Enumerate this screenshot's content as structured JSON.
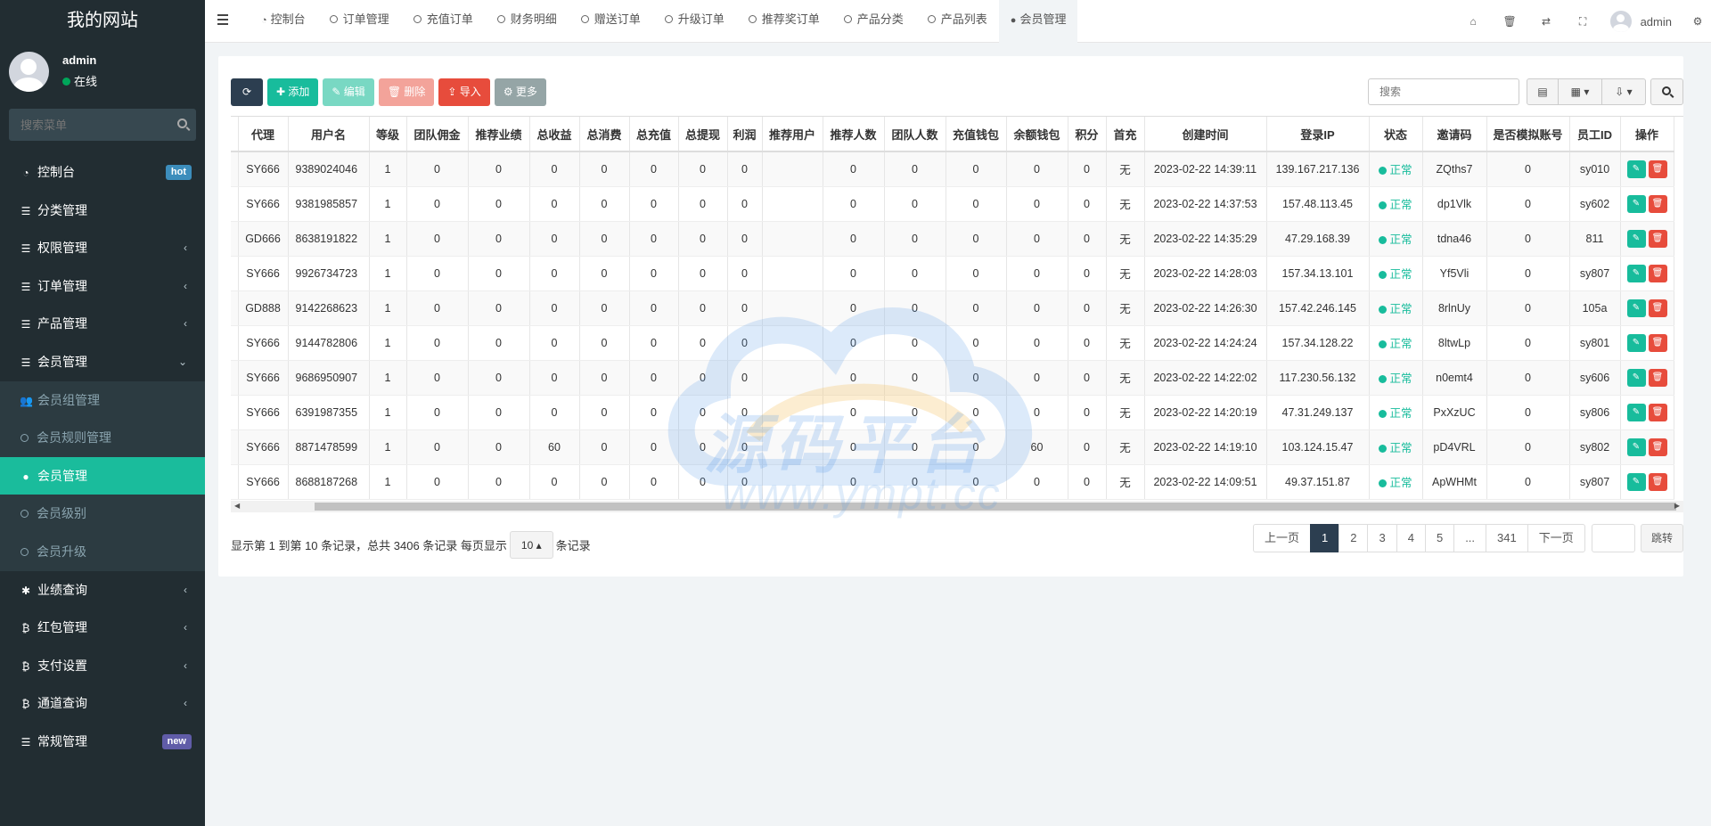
{
  "sidebar": {
    "logo": "我的网站",
    "user": {
      "name": "admin",
      "status": "在线"
    },
    "search_placeholder": "搜索菜单",
    "menu": [
      {
        "label": "控制台",
        "icon": "dashboard-icon",
        "badge": "hot",
        "badge_color": "#3c8dbc"
      },
      {
        "label": "分类管理",
        "icon": "list-icon"
      },
      {
        "label": "权限管理",
        "icon": "list-icon",
        "chevron": "‹"
      },
      {
        "label": "订单管理",
        "icon": "list-icon",
        "chevron": "‹"
      },
      {
        "label": "产品管理",
        "icon": "list-icon",
        "chevron": "‹"
      },
      {
        "label": "会员管理",
        "icon": "list-icon",
        "chevron": "⌄"
      }
    ],
    "submenu": [
      {
        "label": "会员组管理",
        "icon": "users-icon"
      },
      {
        "label": "会员规则管理",
        "icon": "circle-icon"
      },
      {
        "label": "会员管理",
        "icon": "user-icon",
        "active": true
      },
      {
        "label": "会员级别",
        "icon": "circle-icon"
      },
      {
        "label": "会员升级",
        "icon": "circle-icon"
      }
    ],
    "menu2": [
      {
        "label": "业绩查询",
        "icon": "asterisk-icon",
        "chevron": "‹"
      },
      {
        "label": "红包管理",
        "icon": "bitcoin-icon",
        "chevron": "‹"
      },
      {
        "label": "支付设置",
        "icon": "bitcoin-icon",
        "chevron": "‹"
      },
      {
        "label": "通道查询",
        "icon": "bitcoin-icon",
        "chevron": "‹"
      },
      {
        "label": "常规管理",
        "icon": "list-icon",
        "badge": "new",
        "badge_color": "#605ca8"
      }
    ]
  },
  "topbar": {
    "tabs": [
      {
        "label": "控制台",
        "icon": "dashboard-icon"
      },
      {
        "label": "订单管理",
        "icon": "circle-icon"
      },
      {
        "label": "充值订单",
        "icon": "circle-icon"
      },
      {
        "label": "财务明细",
        "icon": "circle-icon"
      },
      {
        "label": "赠送订单",
        "icon": "circle-icon"
      },
      {
        "label": "升级订单",
        "icon": "circle-icon"
      },
      {
        "label": "推荐奖订单",
        "icon": "circle-icon"
      },
      {
        "label": "产品分类",
        "icon": "circle-icon"
      },
      {
        "label": "产品列表",
        "icon": "circle-icon"
      },
      {
        "label": "会员管理",
        "icon": "user-icon",
        "active": true
      }
    ],
    "icons": [
      "home-icon",
      "trash-icon",
      "language-icon",
      "fullscreen-icon"
    ],
    "user": "admin",
    "settings_icon": "gears-icon"
  },
  "toolbar": {
    "refresh": "",
    "add": "添加",
    "edit": "编辑",
    "delete": "删除",
    "import": "导入",
    "more": "更多",
    "search_placeholder": "搜索"
  },
  "table": {
    "columns": [
      "代理",
      "用户名",
      "等级",
      "团队佣金",
      "推荐业绩",
      "总收益",
      "总消费",
      "总充值",
      "总提现",
      "利润",
      "推荐用户",
      "推荐人数",
      "团队人数",
      "充值钱包",
      "余额钱包",
      "积分",
      "首充",
      "创建时间",
      "登录IP",
      "状态",
      "邀请码",
      "是否模拟账号",
      "员工ID",
      "操作"
    ],
    "rows": [
      [
        "SY666",
        "9389024046",
        "1",
        "0",
        "0",
        "0",
        "0",
        "0",
        "0",
        "0",
        "",
        "0",
        "0",
        "0",
        "0",
        "0",
        "无",
        "2023-02-22 14:39:11",
        "139.167.217.136",
        "正常",
        "ZQths7",
        "0",
        "sy010"
      ],
      [
        "SY666",
        "9381985857",
        "1",
        "0",
        "0",
        "0",
        "0",
        "0",
        "0",
        "0",
        "",
        "0",
        "0",
        "0",
        "0",
        "0",
        "无",
        "2023-02-22 14:37:53",
        "157.48.113.45",
        "正常",
        "dp1Vlk",
        "0",
        "sy602"
      ],
      [
        "GD666",
        "8638191822",
        "1",
        "0",
        "0",
        "0",
        "0",
        "0",
        "0",
        "0",
        "",
        "0",
        "0",
        "0",
        "0",
        "0",
        "无",
        "2023-02-22 14:35:29",
        "47.29.168.39",
        "正常",
        "tdna46",
        "0",
        "811"
      ],
      [
        "SY666",
        "9926734723",
        "1",
        "0",
        "0",
        "0",
        "0",
        "0",
        "0",
        "0",
        "",
        "0",
        "0",
        "0",
        "0",
        "0",
        "无",
        "2023-02-22 14:28:03",
        "157.34.13.101",
        "正常",
        "Yf5Vli",
        "0",
        "sy807"
      ],
      [
        "GD888",
        "9142268623",
        "1",
        "0",
        "0",
        "0",
        "0",
        "0",
        "0",
        "0",
        "",
        "0",
        "0",
        "0",
        "0",
        "0",
        "无",
        "2023-02-22 14:26:30",
        "157.42.246.145",
        "正常",
        "8rlnUy",
        "0",
        "105a"
      ],
      [
        "SY666",
        "9144782806",
        "1",
        "0",
        "0",
        "0",
        "0",
        "0",
        "0",
        "0",
        "",
        "0",
        "0",
        "0",
        "0",
        "0",
        "无",
        "2023-02-22 14:24:24",
        "157.34.128.22",
        "正常",
        "8ltwLp",
        "0",
        "sy801"
      ],
      [
        "SY666",
        "9686950907",
        "1",
        "0",
        "0",
        "0",
        "0",
        "0",
        "0",
        "0",
        "",
        "0",
        "0",
        "0",
        "0",
        "0",
        "无",
        "2023-02-22 14:22:02",
        "117.230.56.132",
        "正常",
        "n0emt4",
        "0",
        "sy606"
      ],
      [
        "SY666",
        "6391987355",
        "1",
        "0",
        "0",
        "0",
        "0",
        "0",
        "0",
        "0",
        "",
        "0",
        "0",
        "0",
        "0",
        "0",
        "无",
        "2023-02-22 14:20:19",
        "47.31.249.137",
        "正常",
        "PxXzUC",
        "0",
        "sy806"
      ],
      [
        "SY666",
        "8871478599",
        "1",
        "0",
        "0",
        "60",
        "0",
        "0",
        "0",
        "0",
        "",
        "0",
        "0",
        "0",
        "60",
        "0",
        "无",
        "2023-02-22 14:19:10",
        "103.124.15.47",
        "正常",
        "pD4VRL",
        "0",
        "sy802"
      ],
      [
        "SY666",
        "8688187268",
        "1",
        "0",
        "0",
        "0",
        "0",
        "0",
        "0",
        "0",
        "",
        "0",
        "0",
        "0",
        "0",
        "0",
        "无",
        "2023-02-22 14:09:51",
        "49.37.151.87",
        "正常",
        "ApWHMt",
        "0",
        "sy807"
      ]
    ]
  },
  "footer": {
    "info_prefix": "显示第 1 到第 10 条记录，总共 3406 条记录 每页显示",
    "page_size": "10",
    "info_suffix": "条记录",
    "pages": [
      "上一页",
      "1",
      "2",
      "3",
      "4",
      "5",
      "...",
      "341",
      "下一页"
    ],
    "current_page": "1",
    "jump": "跳转"
  },
  "watermark": {
    "title": "源码平台",
    "url": "www.ympt.cc"
  }
}
